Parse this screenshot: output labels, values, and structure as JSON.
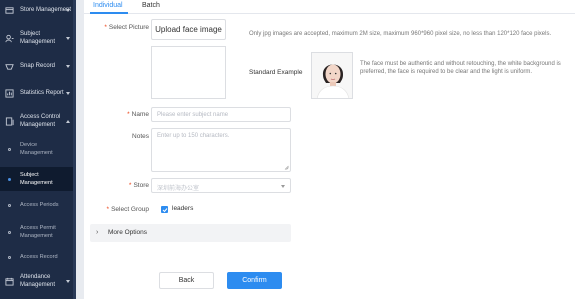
{
  "sidebar": {
    "items": [
      {
        "label": "Store Management",
        "icon": "store-icon",
        "expanded": false
      },
      {
        "label": "Subject Management",
        "icon": "subject-icon",
        "expanded": false
      },
      {
        "label": "Snap Record",
        "icon": "snap-icon",
        "expanded": false
      },
      {
        "label": "Statistics Report",
        "icon": "chart-icon",
        "expanded": false
      },
      {
        "label": "Access Control Management",
        "icon": "access-control-icon",
        "expanded": true
      },
      {
        "label": "Attendance Management",
        "icon": "calendar-icon",
        "expanded": false
      }
    ],
    "subitems": [
      {
        "label": "Device Management",
        "active": false
      },
      {
        "label": "Subject Management",
        "active": true
      },
      {
        "label": "Access Periods",
        "active": false
      },
      {
        "label": "Access Permit Management",
        "active": false
      },
      {
        "label": "Access Record",
        "active": false
      }
    ]
  },
  "tabs": [
    {
      "label": "Individual",
      "active": true
    },
    {
      "label": "Batch",
      "active": false
    }
  ],
  "form": {
    "picture": {
      "label": "Select Picture",
      "upload_label": "Upload face image",
      "hint": "Only jpg images are accepted, maximum 2M size, maximum 960*960 pixel size, no less than 120*120 face pixels.",
      "standard_label": "Standard Example",
      "standard_desc": "The face must be authentic and without retouching, the white background is preferred, the face is required to be clear and the light is uniform."
    },
    "name": {
      "label": "Name",
      "placeholder": "Please enter subject name"
    },
    "notes": {
      "label": "Notes",
      "placeholder": "Enter up to 150 characters."
    },
    "store": {
      "label": "Store",
      "placeholder": "深圳前海办公室"
    },
    "group": {
      "label": "Select Group",
      "option": "leaders",
      "checked": true
    },
    "more_options": "More Options",
    "back_label": "Back",
    "confirm_label": "Confirm"
  },
  "colors": {
    "accent": "#2d8cf0",
    "sidebar_bg": "#1e2c46",
    "required": "#ed4014"
  }
}
